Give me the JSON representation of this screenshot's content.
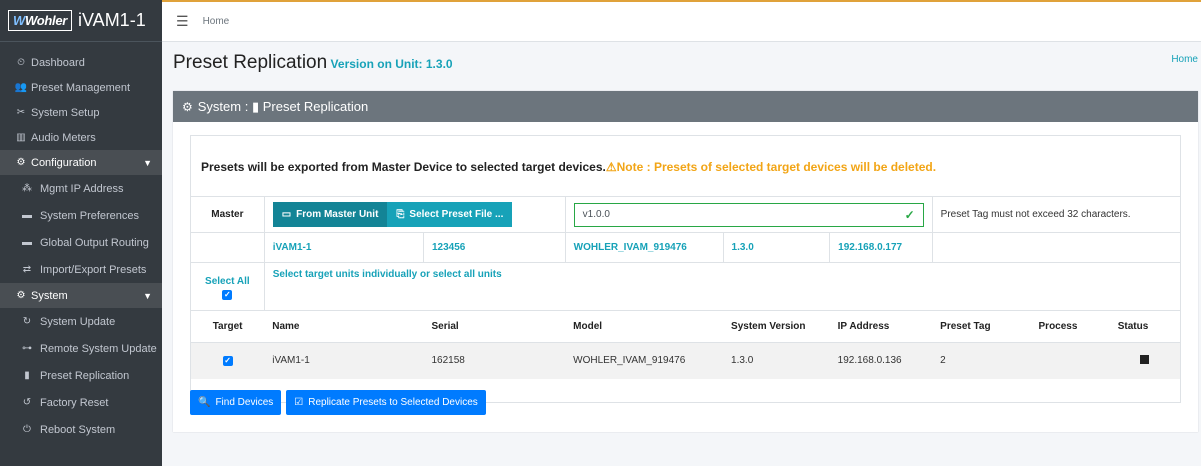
{
  "app": {
    "logo_text": "Wohler",
    "device_name": "iVAM1-1"
  },
  "sidebar": {
    "items": [
      {
        "label": "Dashboard",
        "icon": "dashboard-icon",
        "glyph": "⏲"
      },
      {
        "label": "Preset Management",
        "icon": "users-icon",
        "glyph": "👥"
      },
      {
        "label": "System Setup",
        "icon": "tools-icon",
        "glyph": "✂"
      },
      {
        "label": "Audio Meters",
        "icon": "chart-icon",
        "glyph": "▥"
      }
    ],
    "groups": [
      {
        "label": "Configuration",
        "icon": "gear-icon",
        "glyph": "⚙",
        "items": [
          {
            "label": "Mgmt IP Address",
            "icon": "network-icon",
            "glyph": "⁂"
          },
          {
            "label": "System Preferences",
            "icon": "list-icon",
            "glyph": "▬"
          },
          {
            "label": "Global Output Routing",
            "icon": "routing-icon",
            "glyph": "▬"
          },
          {
            "label": "Import/Export Presets",
            "icon": "exchange-icon",
            "glyph": "⇄"
          }
        ]
      },
      {
        "label": "System",
        "icon": "cogs-icon",
        "glyph": "⚙",
        "items": [
          {
            "label": "System Update",
            "icon": "sync-icon",
            "glyph": "↻"
          },
          {
            "label": "Remote System Update",
            "icon": "remote-icon",
            "glyph": "⊶"
          },
          {
            "label": "Preset Replication",
            "icon": "copy-icon",
            "glyph": "▮"
          },
          {
            "label": "Factory Reset",
            "icon": "undo-icon",
            "glyph": "↺"
          },
          {
            "label": "Reboot System",
            "icon": "power-icon",
            "glyph": "⏻"
          }
        ]
      }
    ]
  },
  "topbar": {
    "home_link": "Home"
  },
  "page": {
    "title": "Preset Replication",
    "version_label": "Version on Unit: 1.3.0",
    "breadcrumb": "Home"
  },
  "card": {
    "header": "System : ▮ Preset Replication"
  },
  "notice": {
    "main": "Presets will be exported from Master Device to selected target devices.",
    "warning": "Note : Presets of selected target devices will be deleted."
  },
  "master": {
    "label": "Master",
    "btn_from_master": "From Master Unit",
    "btn_select_file": "Select Preset File ...",
    "tag_value": "v1.0.0",
    "tag_hint": "Preset Tag must not exceed 32 characters.",
    "info": {
      "name": "iVAM1-1",
      "serial": "123456",
      "model": "WOHLER_IVAM_919476",
      "version": "1.3.0",
      "ip": "192.168.0.177"
    }
  },
  "select": {
    "select_all": "Select All",
    "hint": "Select target units individually or select all units"
  },
  "table": {
    "headers": [
      "Target",
      "Name",
      "Serial",
      "Model",
      "System Version",
      "IP Address",
      "Preset Tag",
      "Process",
      "Status"
    ],
    "rows": [
      {
        "name": "iVAM1-1",
        "serial": "162158",
        "model": "WOHLER_IVAM_919476",
        "version": "1.3.0",
        "ip": "192.168.0.136",
        "tag": "2",
        "process": ""
      }
    ]
  },
  "actions": {
    "find": "Find Devices",
    "replicate": "Replicate Presets to Selected Devices"
  },
  "colors": {
    "sidebar": "#343a40",
    "teal": "#17a2b8",
    "primary": "#007bff",
    "warning": "#f2a516",
    "success": "#28a745"
  }
}
